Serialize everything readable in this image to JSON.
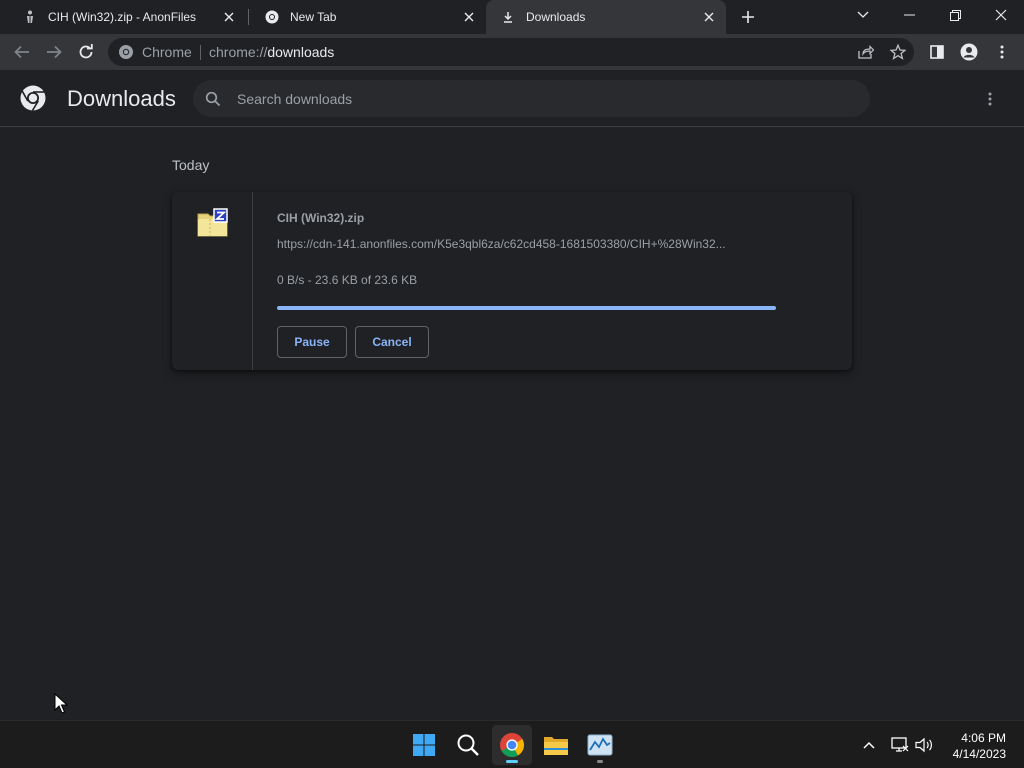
{
  "tabs": [
    {
      "title": "CIH (Win32).zip - AnonFiles",
      "favicon": "anonfiles-icon"
    },
    {
      "title": "New Tab",
      "favicon": "chrome-icon"
    },
    {
      "title": "Downloads",
      "favicon": "download-icon",
      "active": true
    }
  ],
  "omnibox": {
    "site_chip": "Chrome",
    "url_scheme": "chrome://",
    "url_host": "downloads"
  },
  "page": {
    "title": "Downloads",
    "search_placeholder": "Search downloads"
  },
  "downloads": {
    "date_group": "Today",
    "items": [
      {
        "file_name": "CIH (Win32).zip",
        "url": "https://cdn-141.anonfiles.com/K5e3qbl6za/c62cd458-1681503380/CIH+%28Win32...",
        "status": "0 B/s - 23.6 KB of 23.6 KB",
        "progress": 1.0,
        "pause_label": "Pause",
        "cancel_label": "Cancel"
      }
    ]
  },
  "taskbar": {
    "apps": [
      "windows-start-icon",
      "search-icon",
      "chrome-icon",
      "file-explorer-icon",
      "task-manager-icon"
    ],
    "clock_time": "4:06 PM",
    "clock_date": "4/14/2023"
  },
  "colors": {
    "accent": "#8ab4f8",
    "background": "#202124",
    "toolbar": "#35363a",
    "taskbar_indicator": "#60cdff"
  }
}
